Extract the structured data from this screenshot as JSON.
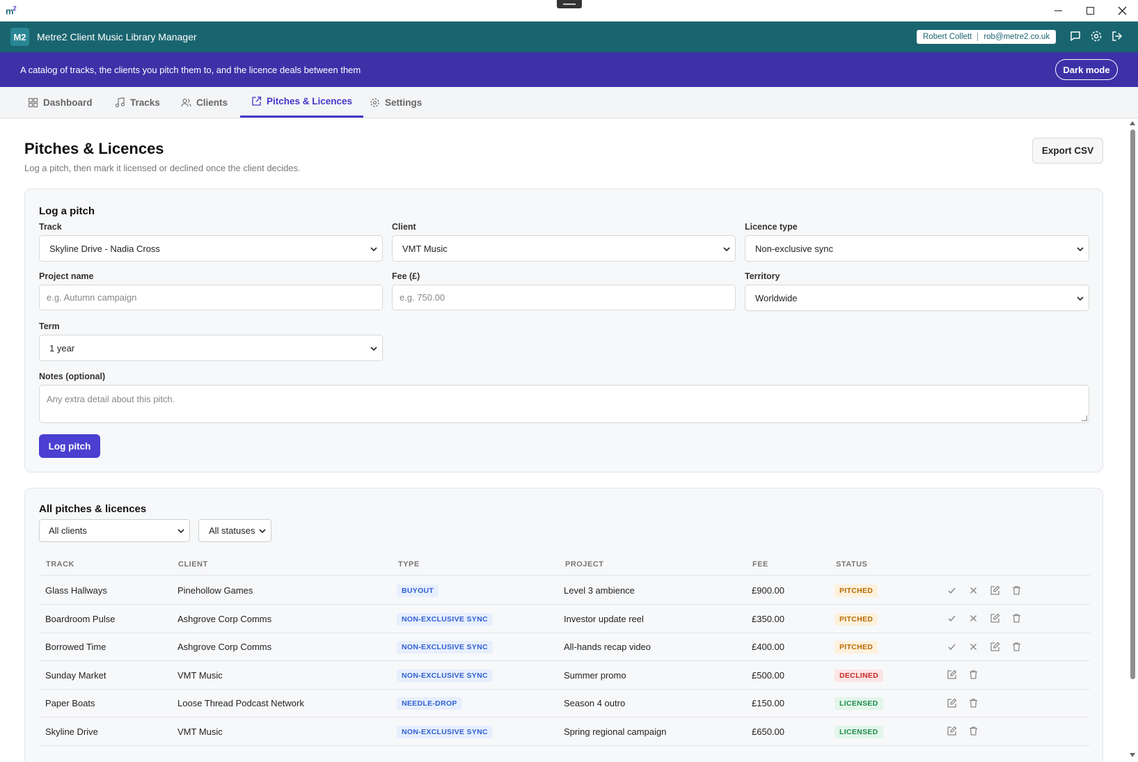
{
  "window": {
    "logo": "m",
    "logo_sup": "2"
  },
  "header": {
    "badge": "M2",
    "title": "Metre2 Client Music Library Manager",
    "user_name": "Robert Collett",
    "user_email": "rob@metre2.co.uk"
  },
  "banner": {
    "text": "A catalog of tracks, the clients you pitch them to, and the licence deals between them",
    "dark_mode_label": "Dark mode"
  },
  "tabs": [
    {
      "label": "Dashboard",
      "icon": "dashboard-icon"
    },
    {
      "label": "Tracks",
      "icon": "music-note-icon"
    },
    {
      "label": "Clients",
      "icon": "users-icon"
    },
    {
      "label": "Pitches & Licences",
      "icon": "share-icon"
    },
    {
      "label": "Settings",
      "icon": "gear-icon"
    }
  ],
  "page": {
    "title": "Pitches & Licences",
    "subtitle": "Log a pitch, then mark it licensed or declined once the client decides.",
    "export_label": "Export CSV"
  },
  "form": {
    "heading": "Log a pitch",
    "track_label": "Track",
    "track_value": "Skyline Drive - Nadia Cross",
    "client_label": "Client",
    "client_value": "VMT Music",
    "licence_label": "Licence type",
    "licence_value": "Non-exclusive sync",
    "project_label": "Project name",
    "project_placeholder": "e.g. Autumn campaign",
    "fee_label": "Fee (£)",
    "fee_placeholder": "e.g. 750.00",
    "territory_label": "Territory",
    "territory_value": "Worldwide",
    "term_label": "Term",
    "term_value": "1 year",
    "notes_label": "Notes (optional)",
    "notes_placeholder": "Any extra detail about this pitch.",
    "submit_label": "Log pitch"
  },
  "list": {
    "heading": "All pitches & licences",
    "client_filter": "All clients",
    "status_filter": "All statuses",
    "columns": [
      "TRACK",
      "CLIENT",
      "TYPE",
      "PROJECT",
      "FEE",
      "STATUS"
    ],
    "rows": [
      {
        "track": "Glass Hallways",
        "client": "Pinehollow Games",
        "type": "BUYOUT",
        "project": "Level 3 ambience",
        "fee": "£900.00",
        "status": "PITCHED"
      },
      {
        "track": "Boardroom Pulse",
        "client": "Ashgrove Corp Comms",
        "type": "NON-EXCLUSIVE SYNC",
        "project": "Investor update reel",
        "fee": "£350.00",
        "status": "PITCHED"
      },
      {
        "track": "Borrowed Time",
        "client": "Ashgrove Corp Comms",
        "type": "NON-EXCLUSIVE SYNC",
        "project": "All-hands recap video",
        "fee": "£400.00",
        "status": "PITCHED"
      },
      {
        "track": "Sunday Market",
        "client": "VMT Music",
        "type": "NON-EXCLUSIVE SYNC",
        "project": "Summer promo",
        "fee": "£500.00",
        "status": "DECLINED"
      },
      {
        "track": "Paper Boats",
        "client": "Loose Thread Podcast Network",
        "type": "NEEDLE-DROP",
        "project": "Season 4 outro",
        "fee": "£150.00",
        "status": "LICENSED"
      },
      {
        "track": "Skyline Drive",
        "client": "VMT Music",
        "type": "NON-EXCLUSIVE SYNC",
        "project": "Spring regional campaign",
        "fee": "£650.00",
        "status": "LICENSED"
      }
    ]
  },
  "status_colors": {
    "PITCHED": {
      "bg": "#fdf1dc",
      "fg": "#b86a00"
    },
    "DECLINED": {
      "bg": "#fde5e5",
      "fg": "#c62828"
    },
    "LICENSED": {
      "bg": "#e2f6ea",
      "fg": "#1f8a4c"
    }
  },
  "colors": {
    "header": "#19656f",
    "banner": "#3d31a8",
    "accent": "#4338ca"
  }
}
